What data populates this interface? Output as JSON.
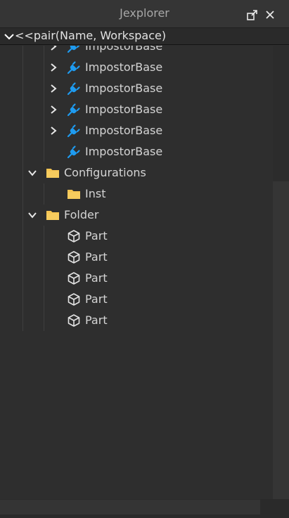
{
  "window": {
    "title": "Jexplorer"
  },
  "titlebar": {
    "dock_icon": "undock-icon",
    "close_icon": "close-icon"
  },
  "root": {
    "label": "<<pair(Name, Workspace)",
    "icon": "chevron-down-icon"
  },
  "tree": {
    "impostors": [
      {
        "label": "ImpostorBase",
        "icon": "plugin-icon",
        "expandable": true
      },
      {
        "label": "ImpostorBase",
        "icon": "plugin-icon",
        "expandable": true
      },
      {
        "label": "ImpostorBase",
        "icon": "plugin-icon",
        "expandable": true
      },
      {
        "label": "ImpostorBase",
        "icon": "plugin-icon",
        "expandable": true
      },
      {
        "label": "ImpostorBase",
        "icon": "plugin-icon",
        "expandable": true
      },
      {
        "label": "ImpostorBase",
        "icon": "plugin-icon",
        "expandable": false
      }
    ],
    "configurations": {
      "label": "Configurations",
      "icon": "folder-icon",
      "expanded": true,
      "children": [
        {
          "label": "Inst",
          "icon": "folder-icon"
        }
      ]
    },
    "folder": {
      "label": "Folder",
      "icon": "folder-icon",
      "expanded": true,
      "children": [
        {
          "label": "Part",
          "icon": "part-cube-icon"
        },
        {
          "label": "Part",
          "icon": "part-cube-icon"
        },
        {
          "label": "Part",
          "icon": "part-cube-icon"
        },
        {
          "label": "Part",
          "icon": "part-cube-icon"
        },
        {
          "label": "Part",
          "icon": "part-cube-icon"
        }
      ]
    }
  },
  "colors": {
    "accent": "#1e9bf0",
    "folder": "#f5c451",
    "background": "#2e2e2e"
  }
}
